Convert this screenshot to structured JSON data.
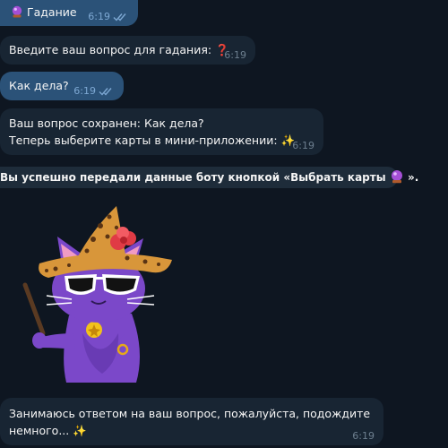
{
  "chat": {
    "messages": [
      {
        "direction": "outgoing",
        "emoji_icon": "crystal-ball-icon",
        "text": "Гадание",
        "time": "6:19",
        "read_status": "double-check-icon"
      },
      {
        "direction": "incoming",
        "text": "Введите ваш вопрос для гадания:",
        "emoji_icon": "red-question-mark-icon",
        "emoji": "❓",
        "time": "6:19"
      },
      {
        "direction": "outgoing",
        "text": "Как дела?",
        "time": "6:19",
        "read_status": "double-check-icon"
      },
      {
        "direction": "incoming",
        "line1": "Ваш вопрос сохранен: Как дела?",
        "line2": "Теперь выберите карты в мини-приложении:",
        "emoji_icon": "sparkles-icon",
        "emoji": "✨",
        "time": "6:19"
      },
      {
        "direction": "incoming",
        "line1": "Занимаюсь ответом на ваш вопрос, пожалуйста, подождите",
        "line2": "немного...",
        "emoji_icon": "sparkles-icon",
        "emoji": "✨",
        "time": "6:19"
      }
    ],
    "service_message": {
      "text": "Вы успешно передали данные боту кнопкой «Выбрать карты",
      "emoji_icon": "crystal-ball-icon",
      "text_end": "»."
    },
    "sticker": {
      "icon": "wizard-cat-sticker-icon"
    }
  },
  "colors": {
    "background": "#0e1621",
    "outgoing_bubble": "#2b5278",
    "incoming_bubble": "#182533",
    "service_bubble": "#1e2c3a",
    "read_check": "#7da8d3",
    "time_incoming": "#6d7f8f"
  }
}
